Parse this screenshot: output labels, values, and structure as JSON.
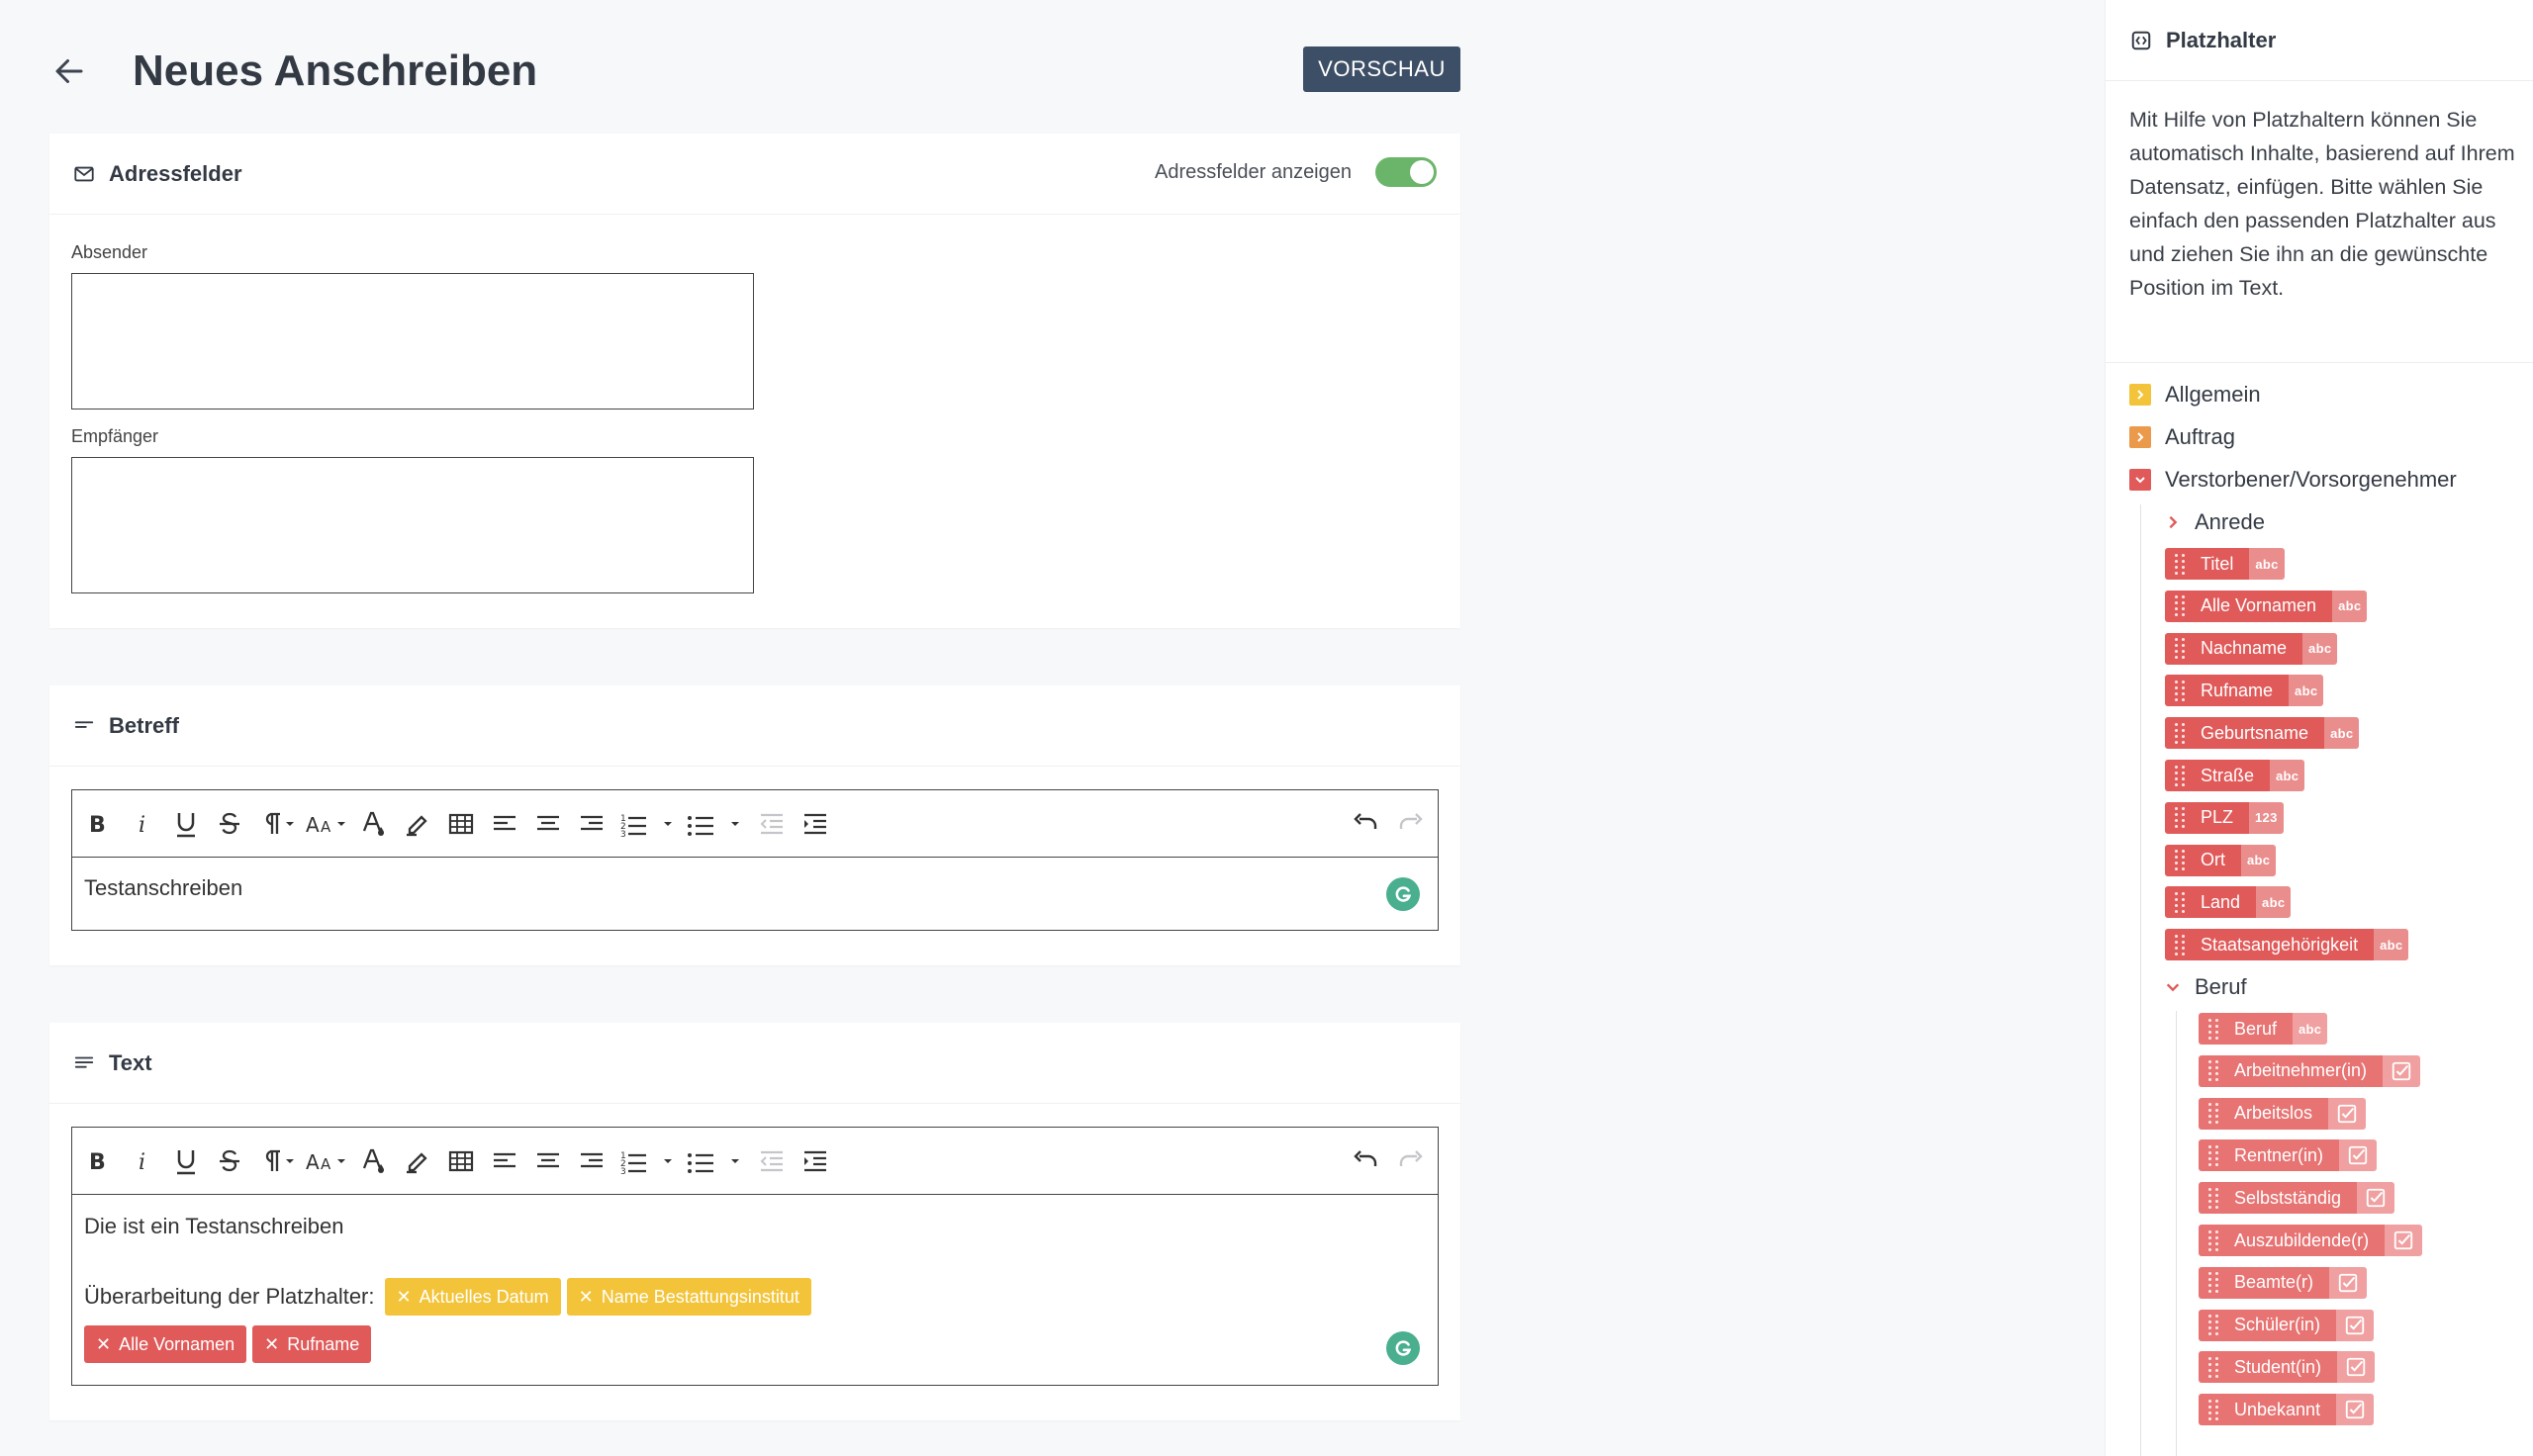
{
  "header": {
    "title": "Neues Anschreiben",
    "preview_label": "VORSCHAU"
  },
  "address_card": {
    "title": "Adressfelder",
    "toggle_label": "Adressfelder anzeigen",
    "toggle_on": true,
    "sender_label": "Absender",
    "recipient_label": "Empfänger"
  },
  "subject_card": {
    "title": "Betreff",
    "content": "Testanschreiben"
  },
  "text_card": {
    "title": "Text",
    "line1": "Die ist ein Testanschreiben",
    "line2_prefix": "Überarbeitung der Platzhalter:",
    "chips_yellow": [
      "Aktuelles Datum",
      "Name Bestattungsinstitut"
    ],
    "chips_red": [
      "Alle Vornamen",
      "Rufname"
    ]
  },
  "panel": {
    "title": "Platzhalter",
    "description": "Mit Hilfe von Platzhaltern können Sie automatisch Inhalte, basierend auf Ihrem Datensatz, einfügen. Bitte wählen Sie einfach den passenden Platzhalter aus und ziehen Sie ihn an die gewünschte Position im Text.",
    "categories": [
      {
        "label": "Allgemein",
        "color": "#f3c43a"
      },
      {
        "label": "Auftrag",
        "color": "#eb9a4c"
      },
      {
        "label": "Verstorbener/Vorsorgenehmer",
        "color": "#e05a5a"
      }
    ],
    "sub_anrede": "Anrede",
    "placeholders": [
      {
        "label": "Titel",
        "type": "abc"
      },
      {
        "label": "Alle Vornamen",
        "type": "abc"
      },
      {
        "label": "Nachname",
        "type": "abc"
      },
      {
        "label": "Rufname",
        "type": "abc"
      },
      {
        "label": "Geburtsname",
        "type": "abc"
      },
      {
        "label": "Straße",
        "type": "abc"
      },
      {
        "label": "PLZ",
        "type": "123"
      },
      {
        "label": "Ort",
        "type": "abc"
      },
      {
        "label": "Land",
        "type": "abc"
      },
      {
        "label": "Staatsangehörigkeit",
        "type": "abc"
      }
    ],
    "sub_beruf": "Beruf",
    "beruf_placeholders": [
      {
        "label": "Beruf",
        "type": "abc"
      },
      {
        "label": "Arbeitnehmer(in)",
        "type": "check"
      },
      {
        "label": "Arbeitslos",
        "type": "check"
      },
      {
        "label": "Rentner(in)",
        "type": "check"
      },
      {
        "label": "Selbstständig",
        "type": "check"
      },
      {
        "label": "Auszubildende(r)",
        "type": "check"
      },
      {
        "label": "Beamte(r)",
        "type": "check"
      },
      {
        "label": "Schüler(in)",
        "type": "check"
      },
      {
        "label": "Student(in)",
        "type": "check"
      },
      {
        "label": "Unbekannt",
        "type": "check"
      }
    ]
  }
}
